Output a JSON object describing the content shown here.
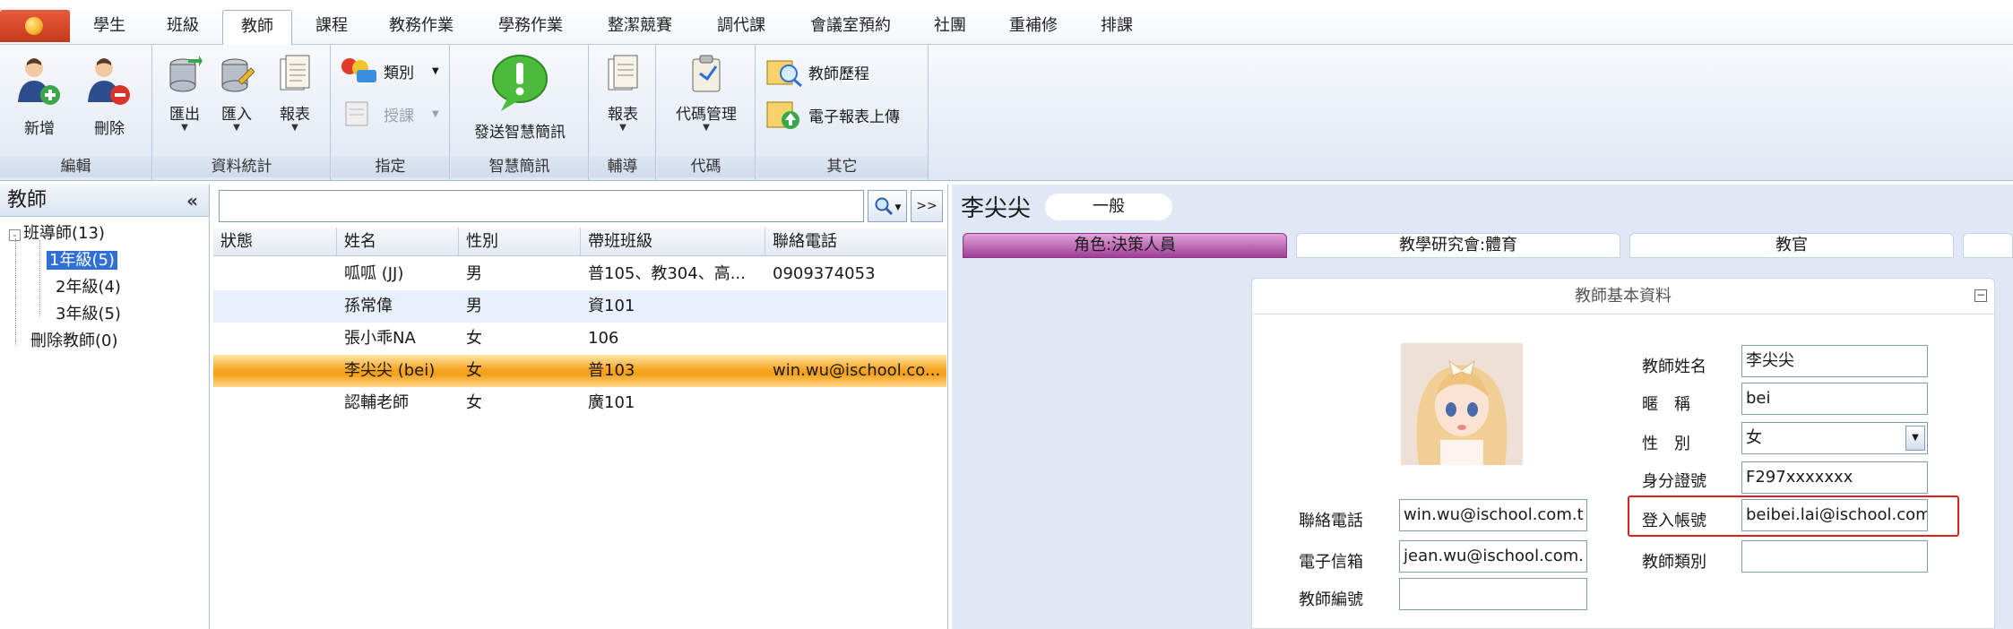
{
  "menu_tabs": [
    "學生",
    "班級",
    "教師",
    "課程",
    "教務作業",
    "學務作業",
    "整潔競賽",
    "調代課",
    "會議室預約",
    "社團",
    "重補修",
    "排課"
  ],
  "active_tab": "教師",
  "ribbon": {
    "edit": {
      "label": "編輯",
      "add": "新增",
      "delete": "刪除"
    },
    "stats": {
      "label": "資料統計",
      "export": "匯出",
      "import": "匯入",
      "report": "報表"
    },
    "assign": {
      "label": "指定",
      "category": "類別",
      "teach": "授課"
    },
    "smart": {
      "label": "智慧簡訊",
      "send": "發送智慧簡訊"
    },
    "guidance": {
      "label": "輔導",
      "report": "報表"
    },
    "code": {
      "label": "代碼",
      "manage": "代碼管理"
    },
    "other": {
      "label": "其它",
      "history": "教師歷程",
      "upload": "電子報表上傳"
    }
  },
  "left_panel": {
    "title": "教師",
    "collapse": "«",
    "tree": [
      {
        "label": "班導師(13)",
        "toggle": "-"
      },
      {
        "label": "1年級(5)",
        "selected": true
      },
      {
        "label": "2年級(4)"
      },
      {
        "label": "3年級(5)"
      },
      {
        "label": "刪除教師(0)"
      }
    ]
  },
  "search": {
    "placeholder": "",
    "more": ">>"
  },
  "grid": {
    "columns": [
      "狀態",
      "姓名",
      "性別",
      "帶班班級",
      "聯絡電話"
    ],
    "rows": [
      {
        "status": "",
        "name": "呱呱 (JJ)",
        "gender": "男",
        "class": "普105、教304、高...",
        "phone": "0909374053"
      },
      {
        "status": "",
        "name": "孫常偉",
        "gender": "男",
        "class": "資101",
        "phone": ""
      },
      {
        "status": "",
        "name": "張小乖NA",
        "gender": "女",
        "class": "106",
        "phone": ""
      },
      {
        "status": "",
        "name": "李尖尖 (bei)",
        "gender": "女",
        "class": "普103",
        "phone": "win.wu@ischool.co..."
      },
      {
        "status": "",
        "name": "認輔老師",
        "gender": "女",
        "class": "廣101",
        "phone": ""
      }
    ]
  },
  "detail": {
    "name": "李尖尖",
    "category": "一般",
    "roles": [
      "角色:決策人員",
      "教學研究會:體育",
      "教官"
    ],
    "card_title": "教師基本資料",
    "collapse": "−",
    "labels": {
      "teacher_name": "教師姓名",
      "nickname": "暱　稱",
      "gender": "性　別",
      "id_number": "身分證號",
      "login": "登入帳號",
      "teacher_type": "教師類別",
      "phone": "聯絡電話",
      "email": "電子信箱",
      "teacher_no": "教師編號"
    },
    "values": {
      "teacher_name": "李尖尖",
      "nickname": "bei",
      "gender": "女",
      "id_number": "F297xxxxxxx",
      "login": "beibei.lai@ischool.com",
      "teacher_type": "",
      "phone": "win.wu@ischool.com.t",
      "email": "jean.wu@ischool.com.",
      "teacher_no": ""
    }
  },
  "colors": {
    "accent_orange": "#f9a624",
    "selection_blue": "#2f6fd6",
    "highlight_red": "#e0201a",
    "role_purple": "#a03e98"
  }
}
